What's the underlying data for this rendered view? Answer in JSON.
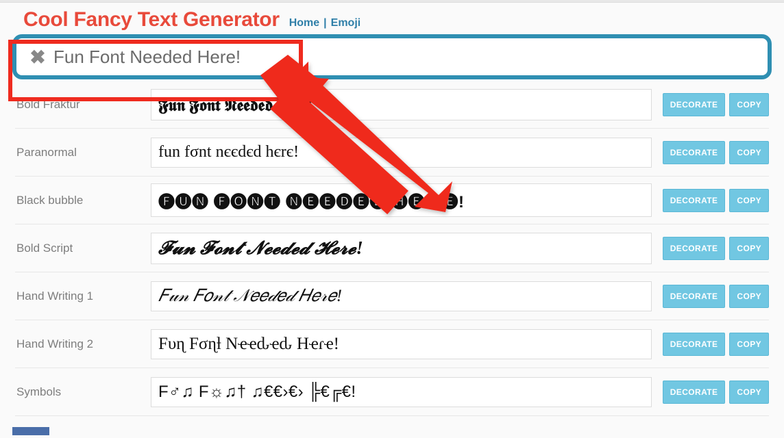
{
  "header": {
    "site_title": "Cool Fancy Text Generator",
    "nav_home": "Home",
    "nav_sep": "|",
    "nav_emoji": "Emoji"
  },
  "input": {
    "value": "Fun Font Needed Here!",
    "clear_icon": "✖"
  },
  "buttons": {
    "decorate": "DECORATE",
    "copy": "COPY"
  },
  "rows": [
    {
      "name": "Bold Fraktur",
      "css": "out-fraktur",
      "output": "𝕱𝖚𝖓 𝕱𝖔𝖓𝖙 𝕹𝖊𝖊𝖉𝖊𝖉 𝕳𝖊𝖗𝖊!"
    },
    {
      "name": "Paranormal",
      "css": "out-paranormal",
      "output": "fun fσnt nєєdєd hєrє!"
    },
    {
      "name": "Black bubble",
      "css": "out-blackbubble",
      "output": "🅕🅤🅝 🅕🅞🅝🅣 🅝🅔🅔🅓🅔🅓 🅗🅔🅡🅔!"
    },
    {
      "name": "Bold Script",
      "css": "out-boldscript",
      "output": "𝓕𝓾𝓷 𝓕𝓸𝓷𝓽 𝓝𝓮𝓮𝓭𝓮𝓭 𝓗𝓮𝓻𝓮!"
    },
    {
      "name": "Hand Writing 1",
      "css": "out-hw1",
      "output": "𝐹𝓊𝓃 𝐹𝑜𝓃𝓉 𝒩𝑒𝑒𝒹𝑒𝒹 𝐻𝑒𝓇𝑒!"
    },
    {
      "name": "Hand Writing 2",
      "css": "out-hw2",
      "output": "Fυɳ Fσɳƚ Nҽҽԃҽԃ Hҽɾҽ!"
    },
    {
      "name": "Symbols",
      "css": "out-symbols",
      "output": "F♂♫ F☼♫† ♫€€›€› ╠€╔€!"
    }
  ]
}
